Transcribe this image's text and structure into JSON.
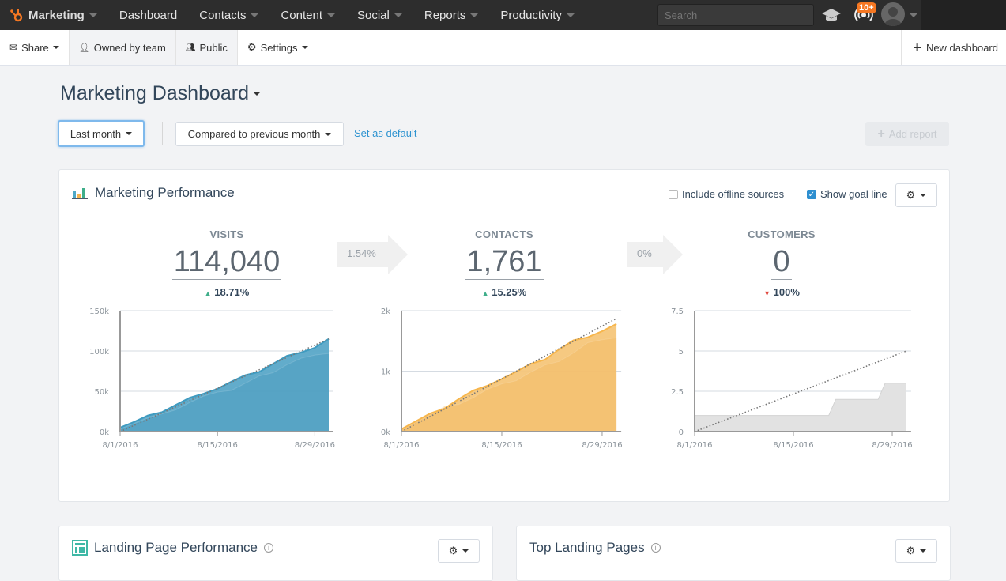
{
  "topnav": {
    "brand": "Marketing",
    "items": [
      {
        "label": "Dashboard",
        "dropdown": false
      },
      {
        "label": "Contacts",
        "dropdown": true
      },
      {
        "label": "Content",
        "dropdown": true
      },
      {
        "label": "Social",
        "dropdown": true
      },
      {
        "label": "Reports",
        "dropdown": true
      },
      {
        "label": "Productivity",
        "dropdown": true
      }
    ],
    "search_placeholder": "Search",
    "notifications_badge": "10+",
    "accent": "#f57722"
  },
  "subnav": {
    "share": "Share",
    "owned": "Owned by team",
    "public": "Public",
    "settings": "Settings",
    "new_dashboard": "New dashboard"
  },
  "page": {
    "title": "Marketing Dashboard",
    "date_range": "Last month",
    "comparison": "Compared to previous month",
    "set_default": "Set as default",
    "add_report": "Add report"
  },
  "performance": {
    "title": "Marketing Performance",
    "include_offline": {
      "label": "Include offline sources",
      "checked": false
    },
    "show_goal": {
      "label": "Show goal line",
      "checked": true
    },
    "metrics": [
      {
        "label": "VISITS",
        "value": "114,040",
        "change": "18.71%",
        "direction": "up"
      },
      {
        "label": "CONTACTS",
        "value": "1,761",
        "change": "15.25%",
        "direction": "up"
      },
      {
        "label": "CUSTOMERS",
        "value": "0",
        "change": "100%",
        "direction": "down"
      }
    ],
    "conversions": [
      "1.54%",
      "0%"
    ]
  },
  "chart_data": [
    {
      "type": "area",
      "metric": "Visits",
      "x_ticks": [
        "8/1/2016",
        "8/15/2016",
        "8/29/2016"
      ],
      "y_ticks": [
        "0k",
        "50k",
        "100k",
        "150k"
      ],
      "ylim": [
        0,
        150000
      ],
      "x": [
        "2016-08-01",
        "2016-08-03",
        "2016-08-05",
        "2016-08-07",
        "2016-08-09",
        "2016-08-11",
        "2016-08-13",
        "2016-08-15",
        "2016-08-17",
        "2016-08-19",
        "2016-08-21",
        "2016-08-23",
        "2016-08-25",
        "2016-08-27",
        "2016-08-29",
        "2016-08-31"
      ],
      "series": [
        {
          "role": "previous",
          "values": [
            3000,
            10000,
            17000,
            22000,
            27000,
            36000,
            44000,
            49000,
            51000,
            60000,
            69000,
            73000,
            83000,
            91000,
            95000,
            97000
          ]
        },
        {
          "role": "current",
          "values": [
            5000,
            12000,
            20000,
            24000,
            33000,
            42000,
            47000,
            53000,
            62000,
            70000,
            74000,
            84000,
            94000,
            98000,
            104000,
            115000
          ]
        }
      ],
      "goal": [
        0,
        115000
      ],
      "color": "#5aa8c8",
      "grid": true
    },
    {
      "type": "area",
      "metric": "Contacts",
      "x_ticks": [
        "8/1/2016",
        "8/15/2016",
        "8/29/2016"
      ],
      "y_ticks": [
        "0k",
        "1k",
        "2k"
      ],
      "ylim": [
        0,
        2000
      ],
      "x": [
        "2016-08-01",
        "2016-08-03",
        "2016-08-05",
        "2016-08-07",
        "2016-08-09",
        "2016-08-11",
        "2016-08-13",
        "2016-08-15",
        "2016-08-17",
        "2016-08-19",
        "2016-08-21",
        "2016-08-23",
        "2016-08-25",
        "2016-08-27",
        "2016-08-29",
        "2016-08-31"
      ],
      "series": [
        {
          "role": "previous",
          "values": [
            30,
            150,
            280,
            420,
            450,
            560,
            700,
            790,
            840,
            980,
            1100,
            1160,
            1300,
            1470,
            1520,
            1550
          ]
        },
        {
          "role": "current",
          "values": [
            40,
            170,
            300,
            380,
            540,
            680,
            760,
            870,
            990,
            1120,
            1190,
            1360,
            1510,
            1560,
            1660,
            1780
          ]
        }
      ],
      "goal": [
        0,
        1870
      ],
      "color": "#f5c67a",
      "grid": true
    },
    {
      "type": "area",
      "metric": "Customers",
      "x_ticks": [
        "8/1/2016",
        "8/15/2016",
        "8/29/2016"
      ],
      "y_ticks": [
        "0",
        "2.5",
        "5",
        "7.5"
      ],
      "ylim": [
        0,
        7.5
      ],
      "x": [
        "2016-08-01",
        "2016-08-20",
        "2016-08-21",
        "2016-08-27",
        "2016-08-28",
        "2016-08-31"
      ],
      "series": [
        {
          "role": "previous",
          "values": [
            1,
            1,
            2,
            2,
            3,
            3
          ]
        }
      ],
      "goal": [
        0,
        5
      ],
      "color": "#e2e2e2",
      "grid": true
    }
  ],
  "landing_perf": {
    "title": "Landing Page Performance"
  },
  "top_landing": {
    "title": "Top Landing Pages"
  }
}
